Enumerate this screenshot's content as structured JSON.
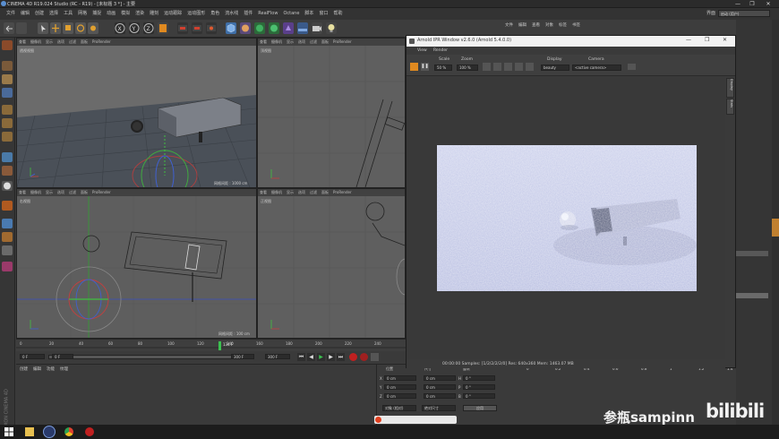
{
  "window": {
    "title": "CINEMA 4D R19.024 Studio (RC - R19) - [未标题 3 *] - 主要",
    "min": "—",
    "max": "❐",
    "close": "✕"
  },
  "menu": [
    "文件",
    "编辑",
    "创建",
    "选择",
    "工具",
    "网格",
    "捕捉",
    "动画",
    "模拟",
    "渲染",
    "雕刻",
    "运动跟踪",
    "运动图形",
    "角色",
    "流水线",
    "插件",
    "RealFlow",
    "Octane",
    "脚本",
    "窗口",
    "帮助"
  ],
  "layout": {
    "label": "界面",
    "value": "启动 (用户)"
  },
  "viewports": [
    {
      "menus": [
        "查看",
        "摄像机",
        "显示",
        "选项",
        "过滤",
        "面板",
        "ProRender"
      ],
      "label": "透视视图",
      "footer": "网格间距 : 1000 cm"
    },
    {
      "menus": [
        "查看",
        "摄像机",
        "显示",
        "选项",
        "过滤",
        "面板",
        "ProRender"
      ],
      "label": "顶视图",
      "footer": ""
    },
    {
      "menus": [
        "查看",
        "摄像机",
        "显示",
        "选项",
        "过滤",
        "面板",
        "ProRender"
      ],
      "label": "右视图",
      "footer": "网格间距 : 100 cm"
    },
    {
      "menus": [
        "查看",
        "摄像机",
        "显示",
        "选项",
        "过滤",
        "面板",
        "ProRender"
      ],
      "label": "正视图",
      "footer": ""
    }
  ],
  "arnold": {
    "title": "Arnold IPR Window v2.6.0 (Arnold 5.4.0.0)",
    "menus": [
      "View",
      "Render"
    ],
    "scale_label": "Scale",
    "scale_value": "50 %",
    "zoom_label": "Zoom",
    "zoom_value": "100 %",
    "display_label": "Display",
    "display_value": "beauty",
    "camera_label": "Camera",
    "camera_value": "<active camera>",
    "status": "00:00:00  Samples: [1/2/2/2/2/0]  Res: 640x360  Mem: 1463.07 MB",
    "side_tabs": [
      "Display",
      "Stats"
    ]
  },
  "right_panel_menus": [
    "文件",
    "编辑",
    "查看",
    "对象",
    "标签",
    "书签"
  ],
  "timeline": {
    "ticks": [
      "0",
      "20",
      "40",
      "60",
      "80",
      "100",
      "120",
      "140",
      "160",
      "180",
      "200",
      "220",
      "240"
    ],
    "current": "134 F",
    "frame_start": "0 F",
    "frame_min": "0 F",
    "frame_max": "300 F",
    "frame_end": "300 F"
  },
  "materials_menus": [
    "创建",
    "编辑",
    "功能",
    "纹理"
  ],
  "coords": {
    "header": "位置",
    "size_header": "尺寸",
    "rot_header": "旋转",
    "rows": [
      {
        "axis": "X",
        "pos": "0 cm",
        "size": "0 cm",
        "raxis": "H",
        "rot": "0 °"
      },
      {
        "axis": "Y",
        "pos": "0 cm",
        "size": "0 cm",
        "raxis": "P",
        "rot": "0 °"
      },
      {
        "axis": "Z",
        "pos": "0 cm",
        "size": "0 cm",
        "raxis": "B",
        "rot": "0 °"
      }
    ],
    "mode": "对象 (相对)",
    "size_mode": "绝对尺寸",
    "apply": "应用"
  },
  "attr_ruler": [
    "0",
    "0.2",
    "0.4",
    "0.6",
    "0.8",
    "1",
    "1.2",
    "1.4",
    "1.6"
  ],
  "maxon": "MAXON CINEMA 4D",
  "watermark": "参瓶sampinn",
  "bilibili": "bilibili"
}
